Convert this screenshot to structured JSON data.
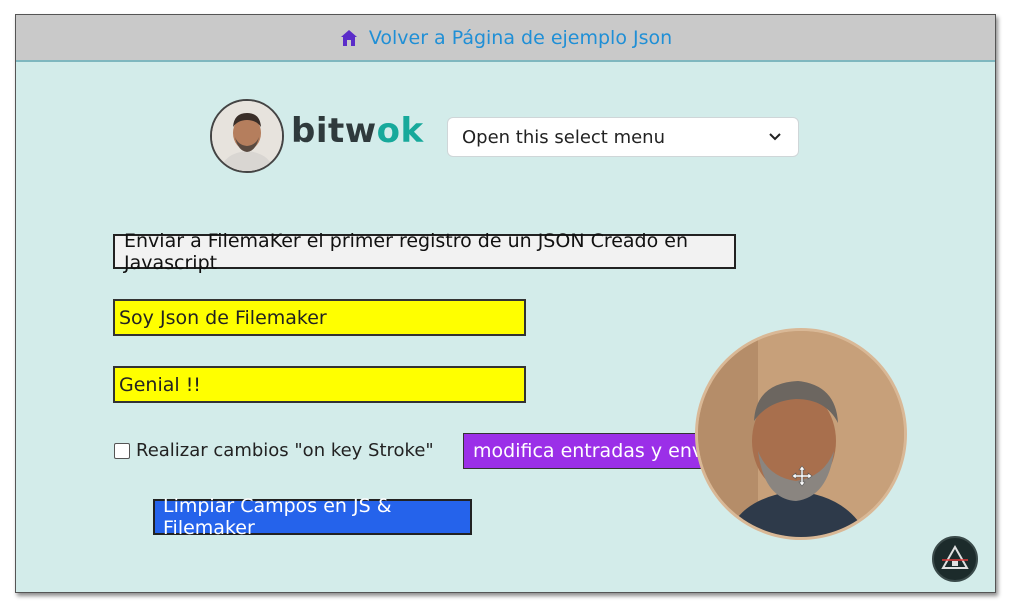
{
  "topbar": {
    "link_text": "Volver a Página de ejemplo Json",
    "icon": "home-icon",
    "link_color": "#1f8fd6"
  },
  "logo": {
    "text_main": "bitw",
    "text_accent": "ok",
    "accent_color": "#17a99b"
  },
  "select": {
    "value": "Open this select menu",
    "icon": "chevron-down-icon"
  },
  "buttons": {
    "send": "Enviar a FilemaKer el primer registro de un JSON Creado en Javascript",
    "modify": "modifica entradas y enviar",
    "clear": "Limpiar Campos en JS & Filemaker"
  },
  "fields": {
    "field1_value": "Soy Json de Filemaker",
    "field2_value": "Genial !!"
  },
  "checkbox": {
    "label": "Realizar cambios \"on key Stroke\"",
    "checked": false
  },
  "colors": {
    "background": "#d3ecea",
    "field_bg": "#ffff00",
    "modify_bg": "#9b2fe8",
    "clear_bg": "#2563eb"
  }
}
